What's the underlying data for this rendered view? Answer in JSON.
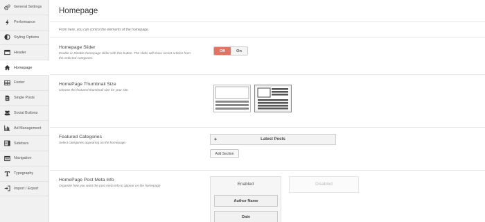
{
  "sidebar": {
    "items": [
      {
        "label": "General Settings",
        "icon": "gears-icon"
      },
      {
        "label": "Performance",
        "icon": "bolt-icon"
      },
      {
        "label": "Styling Options",
        "icon": "contrast-icon"
      },
      {
        "label": "Header",
        "icon": "header-icon"
      },
      {
        "label": "Homepage",
        "icon": "home-icon",
        "active": true
      },
      {
        "label": "Footer",
        "icon": "footer-icon"
      },
      {
        "label": "Single Posts",
        "icon": "document-icon"
      },
      {
        "label": "Social Buttons",
        "icon": "users-icon"
      },
      {
        "label": "Ad Management",
        "icon": "bar-chart-icon"
      },
      {
        "label": "Sidebars",
        "icon": "sidebar-icon"
      },
      {
        "label": "Navigation",
        "icon": "navigation-icon"
      },
      {
        "label": "Typography",
        "icon": "typography-icon"
      },
      {
        "label": "Import / Export",
        "icon": "import-export-icon"
      }
    ]
  },
  "page": {
    "title": "Homepage",
    "intro": "From here, you can control the elements of the homepage."
  },
  "slider": {
    "title": "Homepage Slider",
    "description": "Enable or Disable homepage slider with this button. The slider will show recent articles from the selected categories.",
    "off_label": "Off",
    "on_label": "On",
    "state": "Off"
  },
  "thumbnail": {
    "title": "HomePage Thumbnail Size",
    "description": "Choose the featured thumbnail size for your site.",
    "options": [
      "large-thumbnail",
      "small-thumbnail"
    ],
    "selected": "small-thumbnail"
  },
  "featured": {
    "title": "Featured Categories",
    "description": "Select categories appearing on the homepage.",
    "sections": [
      {
        "plus": "+",
        "name": "Latest Posts"
      }
    ],
    "add_label": "Add Section"
  },
  "meta": {
    "title": "HomePage Post Meta Info",
    "description": "Organize how you want the post meta info to appear on the homepage",
    "enabled_label": "Enabled",
    "disabled_label": "Disabled",
    "enabled_items": [
      "Author Name",
      "Date"
    ]
  },
  "colors": {
    "accent_off": "#e27364",
    "sidebar_bg": "#f1f1f1"
  }
}
